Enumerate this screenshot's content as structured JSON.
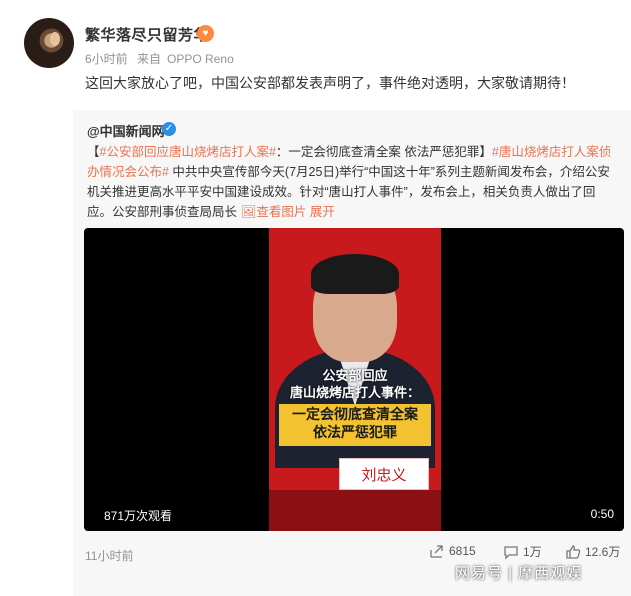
{
  "post": {
    "username": "繁华落尽只留芳华",
    "time": "6小时前",
    "source_prefix": "来自",
    "source_device": "OPPO Reno",
    "text": "这回大家放心了吧，中国公安部都发表声明了，事件绝对透明，大家敬请期待！"
  },
  "repost": {
    "author": "@中国新闻网",
    "bracket_open": "【",
    "tag1": "#公安部回应唐山烧烤店打人案#",
    "headline": "：一定会彻底查清全案 依法严惩犯罪】",
    "tag2": "#唐山烧烤店打人案侦办情况会公布#",
    "body": " 中共中央宣传部今天(7月25日)举行“中国这十年”系列主题新闻发布会，介绍公安机关推进更高水平平安中国建设成效。针对“唐山打人事件”，发布会上，相关负责人做出了回应。公安部刑事侦查局局长",
    "view_images": "查看图片",
    "expand": "展开",
    "video": {
      "caption_line1": "公安部回应",
      "caption_line2": "唐山烧烤店打人事件：",
      "caption_line3": "一定会彻底查清全案",
      "caption_line4": "依法严惩犯罪",
      "nameplate": "刘忠义",
      "views": "871万次观看",
      "duration": "0:50"
    },
    "time": "11小时前",
    "shares": "6815",
    "comments": "1万",
    "likes": "12.6万"
  },
  "watermark": "网易号 | 摩西观娱",
  "colors": {
    "tag": "#eb7350",
    "verify": "#2a8fe6",
    "video_bg": "#c8191d",
    "caption_box": "#f3c230"
  }
}
